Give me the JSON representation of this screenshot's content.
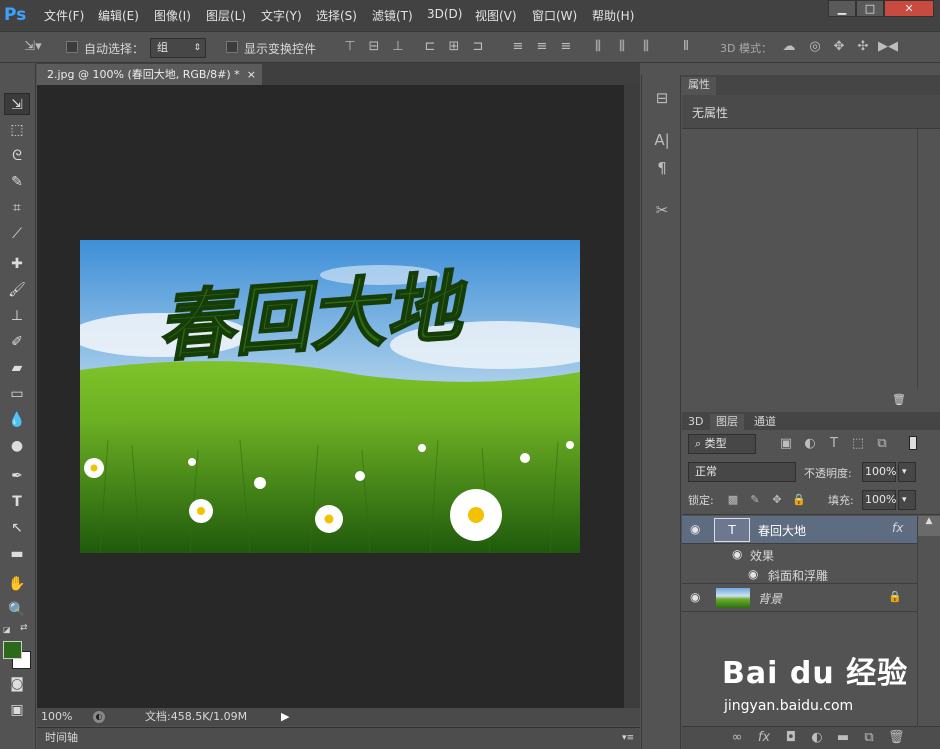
{
  "app": {
    "logo": "Ps"
  },
  "menus": [
    "文件(F)",
    "编辑(E)",
    "图像(I)",
    "图层(L)",
    "文字(Y)",
    "选择(S)",
    "滤镜(T)",
    "3D(D)",
    "视图(V)",
    "窗口(W)",
    "帮助(H)"
  ],
  "window_buttons": [
    "▁",
    "□",
    "✕"
  ],
  "options": {
    "auto_select": "自动选择：",
    "group_value": "组",
    "show_transform": "显示变换控件",
    "mode_3d": "3D 模式："
  },
  "document": {
    "tab_title": "2.jpg @ 100% (春回大地, RGB/8#) *",
    "tab_close": "×",
    "canvas_text": "春回大地"
  },
  "status": {
    "zoom": "100%",
    "doc_info": "文档:458.5K/1.09M"
  },
  "timeline": {
    "label": "时间轴"
  },
  "properties": {
    "tab": "属性",
    "content": "无属性"
  },
  "layers_panel": {
    "tabs": [
      "3D",
      "图层",
      "通道"
    ],
    "filter_kind": "类型",
    "blend_mode": "正常",
    "opacity_label": "不透明度:",
    "opacity_value": "100%",
    "lock_label": "锁定:",
    "fill_label": "填充:",
    "fill_value": "100%",
    "layers": [
      {
        "name": "春回大地",
        "fx": "fx"
      },
      {
        "name": "效果"
      },
      {
        "name": "斜面和浮雕"
      },
      {
        "name": "背景"
      }
    ]
  },
  "watermark": {
    "brand": "Bai du 经验",
    "url": "jingyan.baidu.com"
  },
  "colors": {
    "foreground": "#2c6a1a",
    "background": "#ffffff",
    "accent": "#3aa3ff"
  }
}
